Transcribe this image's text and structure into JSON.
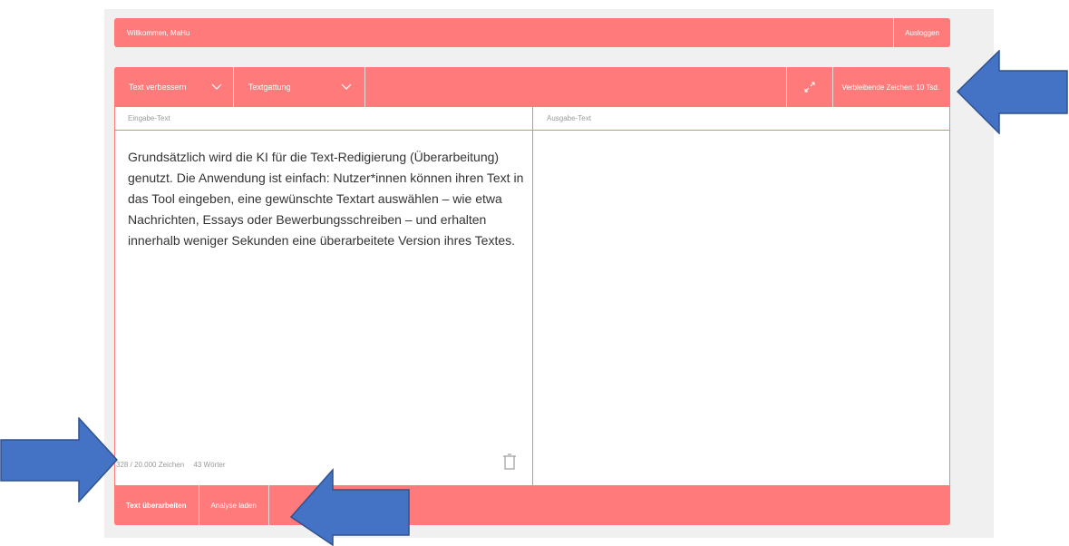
{
  "colors": {
    "accent": "#ff7a7a",
    "annotation_arrow": "#4472c4",
    "page_bg": "#f0f0f0"
  },
  "header": {
    "welcome": "Willkommen, MaHu",
    "logout": "Ausloggen"
  },
  "toolbar": {
    "mode_select": "Text verbessern",
    "genre_select": "Textgattung",
    "expand_icon": "expand-icon",
    "remaining": "Verbleibende Zeichen: 10 Tsd."
  },
  "input_pane": {
    "label": "Eingabe-Text",
    "text": "Grundsätzlich wird die KI für die Text-Redigierung (Überarbeitung) genutzt. Die Anwendung ist einfach: Nutzer*innen können ihren Text in das Tool eingeben, eine gewünschte Textart auswählen – wie etwa Nachrichten, Essays oder Bewerbungsschreiben – und erhalten innerhalb weniger Sekunden eine überarbeitete Version ihres Textes.",
    "char_count": "328 / 20.000 Zeichen",
    "word_count": "43 Wörter",
    "clear_icon": "trash-icon"
  },
  "output_pane": {
    "label": "Ausgabe-Text"
  },
  "actions": {
    "revise": "Text überarbeiten",
    "load_analysis": "Analyse laden"
  }
}
